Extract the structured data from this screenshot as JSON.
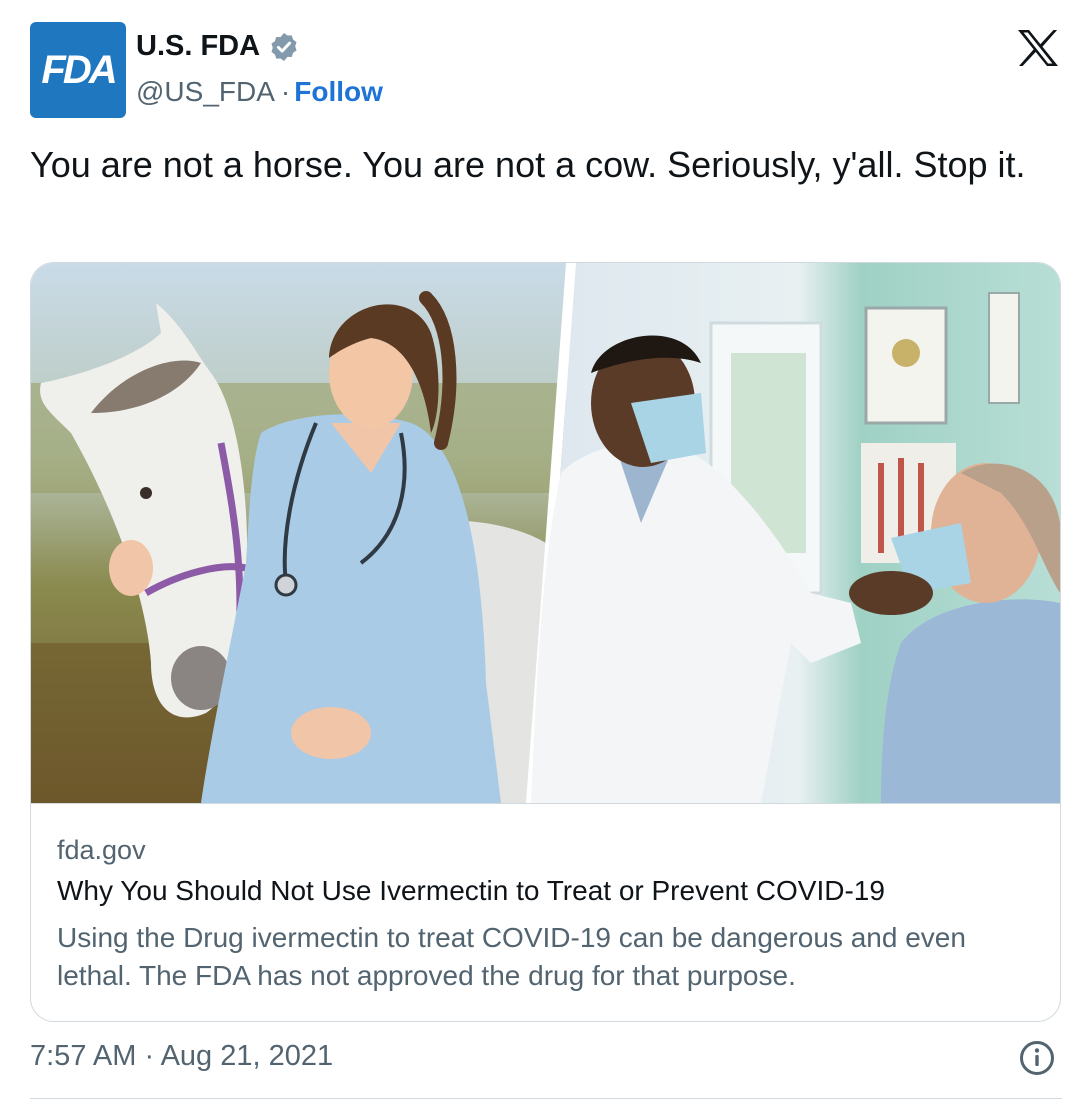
{
  "author": {
    "avatar_text": "FDA",
    "display_name": "U.S. FDA",
    "handle": "@US_FDA",
    "separator": "·",
    "follow_label": "Follow",
    "verified_icon": "verified-badge-icon"
  },
  "tweet": {
    "text": "You are not a horse. You are not a cow. Seriously, y'all. Stop it.",
    "timestamp": "7:57 AM · Aug 21, 2021"
  },
  "link_card": {
    "domain": "fda.gov",
    "title": "Why You Should Not Use Ivermectin to Treat or Prevent COVID-19",
    "description": "Using the Drug ivermectin to treat COVID-19 can be dangerous and even lethal. The FDA has not approved the drug for that purpose."
  },
  "icons": {
    "platform": "x-logo-icon",
    "info": "info-icon"
  },
  "colors": {
    "avatar_bg": "#1f77c0",
    "follow_link": "#1d73d6",
    "secondary_text": "#536471",
    "border": "#cfd9de"
  }
}
